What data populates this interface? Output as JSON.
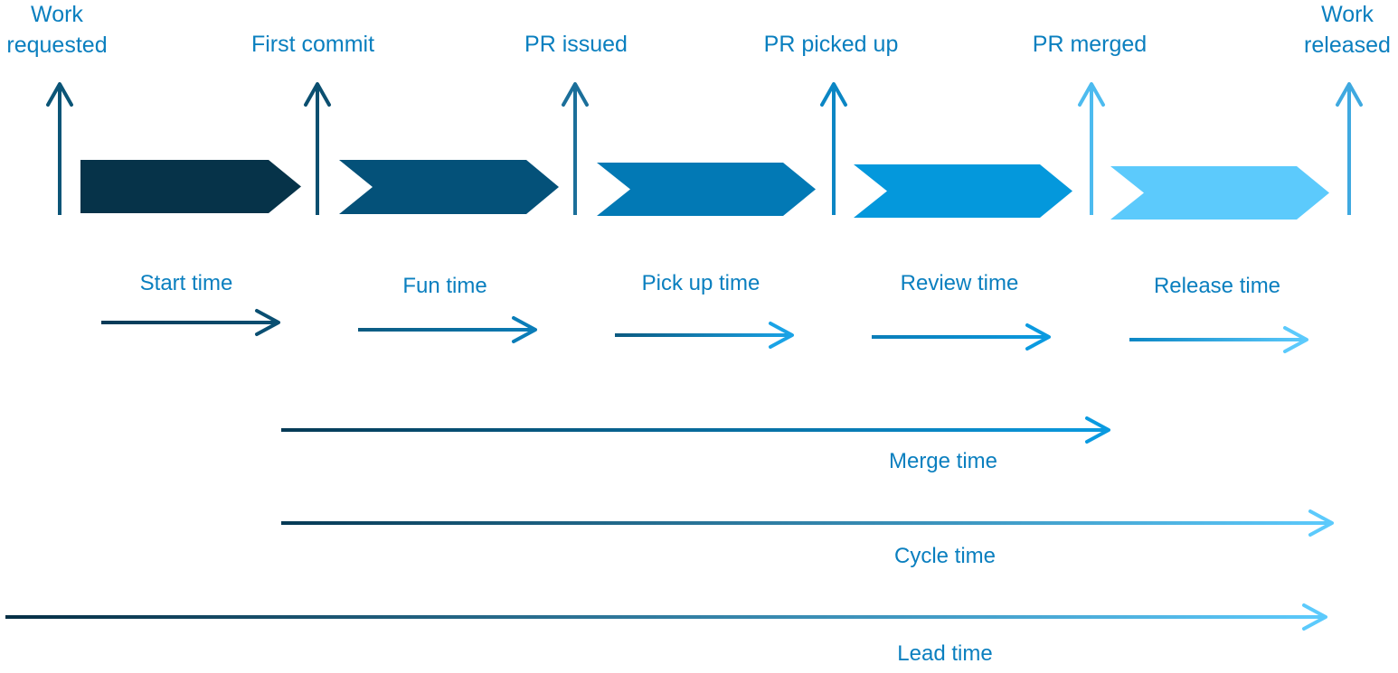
{
  "diagram": {
    "milestones": [
      {
        "label_line1": "Work",
        "label_line2": "requested",
        "color": "#0b5577"
      },
      {
        "label_line1": "",
        "label_line2": "First commit",
        "color": "#0b4f70"
      },
      {
        "label_line1": "",
        "label_line2": "PR issued",
        "color": "#1b6f9a"
      },
      {
        "label_line1": "",
        "label_line2": "PR picked up",
        "color": "#0b86c4"
      },
      {
        "label_line1": "",
        "label_line2": "PR merged",
        "color": "#4dbbef"
      },
      {
        "label_line1": "Work",
        "label_line2": "released",
        "color": "#3fa9e0"
      }
    ],
    "phases": [
      {
        "label": "Start time",
        "color": "#063349",
        "arrow_from": "#053a57",
        "arrow_to": "#0a4f72"
      },
      {
        "label": "Fun time",
        "color": "#045179",
        "arrow_from": "#0b5a80",
        "arrow_to": "#0a7db8"
      },
      {
        "label": "Pick up time",
        "color": "#0279b5",
        "arrow_from": "#0b5a80",
        "arrow_to": "#1aa3e6"
      },
      {
        "label": "Review time",
        "color": "#0498dc",
        "arrow_from": "#0a7db8",
        "arrow_to": "#0b9ae0"
      },
      {
        "label": "Release time",
        "color": "#5ccafc",
        "arrow_from": "#0b86c4",
        "arrow_to": "#5ccafc"
      }
    ],
    "spans": [
      {
        "label": "Merge time",
        "from_milestone": "First commit",
        "to_milestone": "PR merged",
        "arrow_from": "#063a55",
        "arrow_to": "#0a9ae0"
      },
      {
        "label": "Cycle time",
        "from_milestone": "First commit",
        "to_milestone": "Work released",
        "arrow_from": "#063a55",
        "arrow_to": "#5ccafc"
      },
      {
        "label": "Lead time",
        "from_milestone": "Work requested",
        "to_milestone": "Work released",
        "arrow_from": "#062f45",
        "arrow_to": "#5ccafc"
      }
    ],
    "text_color": "#0a7fbf"
  }
}
